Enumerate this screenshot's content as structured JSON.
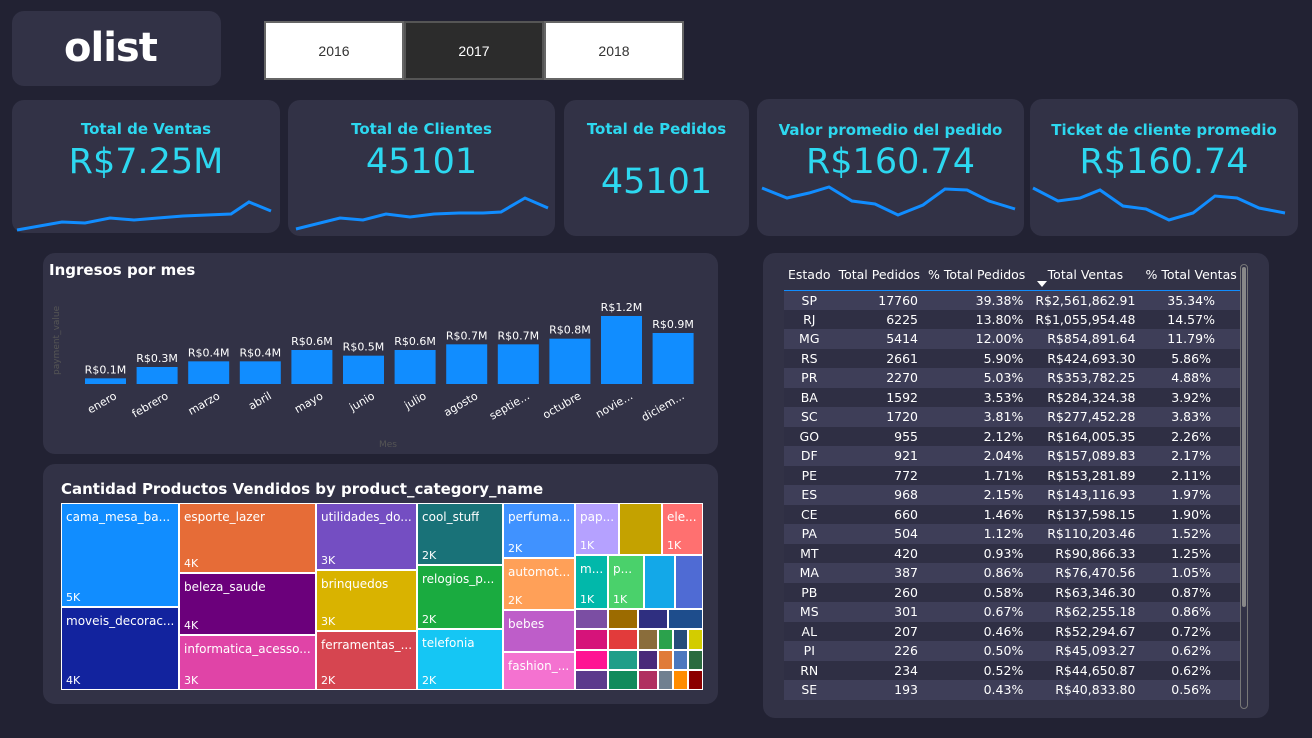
{
  "brand": {
    "logo": "olist"
  },
  "years": {
    "items": [
      "2016",
      "2017",
      "2018"
    ],
    "selected": "2017"
  },
  "kpis": [
    {
      "title": "Total de Ventas",
      "value": "R$7.25M"
    },
    {
      "title": "Total de Clientes",
      "value": "45101"
    },
    {
      "title": "Total de Pedidos",
      "value": "45101"
    },
    {
      "title": "Valor promedio del pedido",
      "value": "R$160.74"
    },
    {
      "title": "Ticket de cliente promedio",
      "value": "R$160.74"
    }
  ],
  "colors": {
    "accent": "#2dd8f0",
    "bar": "#118dff",
    "card": "#323246",
    "background": "#222233"
  },
  "chart_data": [
    {
      "type": "bar",
      "title": "Ingresos por mes",
      "xlabel": "Mes",
      "ylabel": "payment_value",
      "categories": [
        "enero",
        "febrero",
        "marzo",
        "abril",
        "mayo",
        "junio",
        "julio",
        "agosto",
        "septie...",
        "octubre",
        "novie...",
        "diciem..."
      ],
      "values": [
        0.1,
        0.3,
        0.4,
        0.4,
        0.6,
        0.5,
        0.6,
        0.7,
        0.7,
        0.8,
        1.2,
        0.9
      ],
      "value_labels": [
        "R$0.1M",
        "R$0.3M",
        "R$0.4M",
        "R$0.4M",
        "R$0.6M",
        "R$0.5M",
        "R$0.6M",
        "R$0.7M",
        "R$0.7M",
        "R$0.8M",
        "R$1.2M",
        "R$0.9M"
      ]
    },
    {
      "type": "treemap",
      "title": "Cantidad Productos Vendidos by product_category_name",
      "labels": [
        "cama_mesa_ba...",
        "moveis_decorac...",
        "esporte_lazer",
        "beleza_saude",
        "informatica_acesso...",
        "utilidades_do...",
        "brinquedos",
        "ferramentas_...",
        "cool_stuff",
        "relogios_p...",
        "telefonia",
        "perfuma...",
        "automot...",
        "bebes",
        "fashion_...",
        "pap...",
        "ele...",
        "m...",
        "p..."
      ],
      "value_labels": [
        "5K",
        "4K",
        "4K",
        "4K",
        "3K",
        "3K",
        "3K",
        "2K",
        "2K",
        "2K",
        "2K",
        "2K",
        "2K",
        "",
        "",
        "1K",
        "1K",
        "1K",
        "1K"
      ]
    },
    {
      "type": "table",
      "columns": [
        "Estado",
        "Total Pedidos",
        "% Total Pedidos",
        "Total Ventas",
        "% Total Ventas"
      ],
      "rows": [
        [
          "SP",
          "17760",
          "39.38%",
          "R$2,561,862.91",
          "35.34%"
        ],
        [
          "RJ",
          "6225",
          "13.80%",
          "R$1,055,954.48",
          "14.57%"
        ],
        [
          "MG",
          "5414",
          "12.00%",
          "R$854,891.64",
          "11.79%"
        ],
        [
          "RS",
          "2661",
          "5.90%",
          "R$424,693.30",
          "5.86%"
        ],
        [
          "PR",
          "2270",
          "5.03%",
          "R$353,782.25",
          "4.88%"
        ],
        [
          "BA",
          "1592",
          "3.53%",
          "R$284,324.38",
          "3.92%"
        ],
        [
          "SC",
          "1720",
          "3.81%",
          "R$277,452.28",
          "3.83%"
        ],
        [
          "GO",
          "955",
          "2.12%",
          "R$164,005.35",
          "2.26%"
        ],
        [
          "DF",
          "921",
          "2.04%",
          "R$157,089.83",
          "2.17%"
        ],
        [
          "PE",
          "772",
          "1.71%",
          "R$153,281.89",
          "2.11%"
        ],
        [
          "ES",
          "968",
          "2.15%",
          "R$143,116.93",
          "1.97%"
        ],
        [
          "CE",
          "660",
          "1.46%",
          "R$137,598.15",
          "1.90%"
        ],
        [
          "PA",
          "504",
          "1.12%",
          "R$110,203.46",
          "1.52%"
        ],
        [
          "MT",
          "420",
          "0.93%",
          "R$90,866.33",
          "1.25%"
        ],
        [
          "MA",
          "387",
          "0.86%",
          "R$76,470.56",
          "1.05%"
        ],
        [
          "PB",
          "260",
          "0.58%",
          "R$63,346.30",
          "0.87%"
        ],
        [
          "MS",
          "301",
          "0.67%",
          "R$62,255.18",
          "0.86%"
        ],
        [
          "AL",
          "207",
          "0.46%",
          "R$52,294.67",
          "0.72%"
        ],
        [
          "PI",
          "226",
          "0.50%",
          "R$45,093.27",
          "0.62%"
        ],
        [
          "RN",
          "234",
          "0.52%",
          "R$44,650.87",
          "0.62%"
        ],
        [
          "SE",
          "193",
          "0.43%",
          "R$40,833.80",
          "0.56%"
        ]
      ],
      "sorted_by": "Total Ventas",
      "sort_order": "descending"
    }
  ]
}
